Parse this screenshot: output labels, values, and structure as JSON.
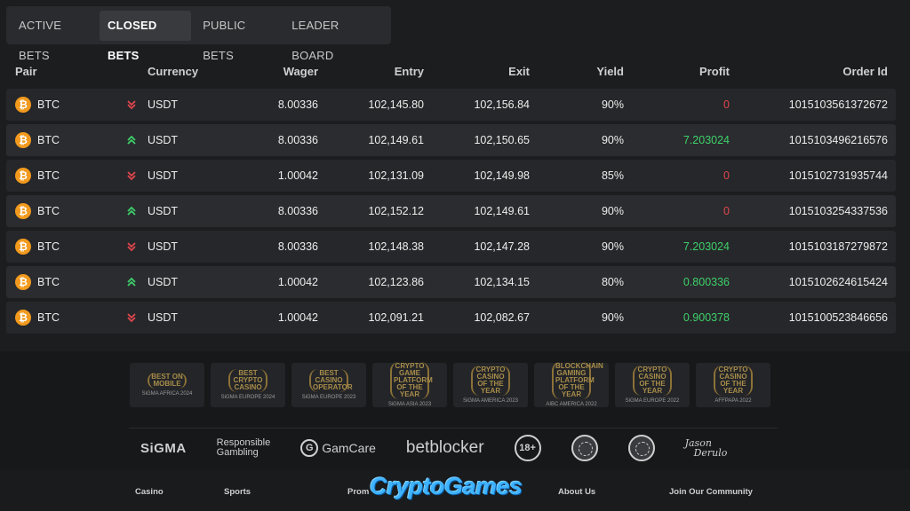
{
  "tabs": [
    {
      "label": "ACTIVE BETS",
      "active": false
    },
    {
      "label": "CLOSED BETS",
      "active": true
    },
    {
      "label": "PUBLIC BETS",
      "active": false
    },
    {
      "label": "LEADER BOARD",
      "active": false
    }
  ],
  "table": {
    "headers": {
      "pair": "Pair",
      "currency": "Currency",
      "wager": "Wager",
      "entry": "Entry",
      "exit": "Exit",
      "yield": "Yield",
      "profit": "Profit",
      "order_id": "Order Id"
    },
    "rows": [
      {
        "pair": "BTC",
        "direction": "down",
        "currency": "USDT",
        "wager": "8.00336",
        "entry": "102,145.80",
        "exit": "102,156.84",
        "yield": "90%",
        "profit": "0",
        "order_id": "1015103561372672"
      },
      {
        "pair": "BTC",
        "direction": "up",
        "currency": "USDT",
        "wager": "8.00336",
        "entry": "102,149.61",
        "exit": "102,150.65",
        "yield": "90%",
        "profit": "7.203024",
        "order_id": "1015103496216576"
      },
      {
        "pair": "BTC",
        "direction": "down",
        "currency": "USDT",
        "wager": "1.00042",
        "entry": "102,131.09",
        "exit": "102,149.98",
        "yield": "85%",
        "profit": "0",
        "order_id": "1015102731935744"
      },
      {
        "pair": "BTC",
        "direction": "up",
        "currency": "USDT",
        "wager": "8.00336",
        "entry": "102,152.12",
        "exit": "102,149.61",
        "yield": "90%",
        "profit": "0",
        "order_id": "1015103254337536"
      },
      {
        "pair": "BTC",
        "direction": "down",
        "currency": "USDT",
        "wager": "8.00336",
        "entry": "102,148.38",
        "exit": "102,147.28",
        "yield": "90%",
        "profit": "7.203024",
        "order_id": "1015103187279872"
      },
      {
        "pair": "BTC",
        "direction": "up",
        "currency": "USDT",
        "wager": "1.00042",
        "entry": "102,123.86",
        "exit": "102,134.15",
        "yield": "80%",
        "profit": "0.800336",
        "order_id": "1015102624615424"
      },
      {
        "pair": "BTC",
        "direction": "down",
        "currency": "USDT",
        "wager": "1.00042",
        "entry": "102,091.21",
        "exit": "102,082.67",
        "yield": "90%",
        "profit": "0.900378",
        "order_id": "1015100523846656"
      }
    ]
  },
  "colors": {
    "profit_zero": "#e0464d",
    "profit_positive": "#3ed16b",
    "btc": "#f29a1e",
    "brand": "#3fb3ff"
  },
  "awards": [
    {
      "title": "BEST ON MOBILE",
      "org": "SiGMA AFRICA 2024"
    },
    {
      "title": "BEST CRYPTO CASINO",
      "org": "SiGMA EUROPE 2024"
    },
    {
      "title": "BEST CASINO OPERATOR",
      "org": "SiGMA EUROPE 2023"
    },
    {
      "title": "CRYPTO GAME PLATFORM OF THE YEAR",
      "org": "SiGMA ASIA 2023"
    },
    {
      "title": "CRYPTO CASINO OF THE YEAR",
      "org": "SiGMA AMERICA 2023"
    },
    {
      "title": "BLOCKCHAIN GAMING PLATFORM OF THE YEAR",
      "org": "AIBC AMERICA 2022"
    },
    {
      "title": "CRYPTO CASINO OF THE YEAR",
      "org": "SiGMA EUROPE 2022"
    },
    {
      "title": "CRYPTO CASINO OF THE YEAR",
      "org": "AFFPAPA 2022"
    }
  ],
  "partners": {
    "sigma": "SiGMA",
    "responsible_line1": "Responsible",
    "responsible_line2": "Gambling",
    "gamcare": "GamCare",
    "betblocker": "betblocker",
    "age": "18+",
    "signature_line1": "Jason",
    "signature_line2": "Derulo"
  },
  "footer_nav": {
    "casino": "Casino",
    "sports": "Sports",
    "promotions": "Prom",
    "about": "About Us",
    "community": "Join Our Community"
  },
  "brand": "CryptoGames"
}
